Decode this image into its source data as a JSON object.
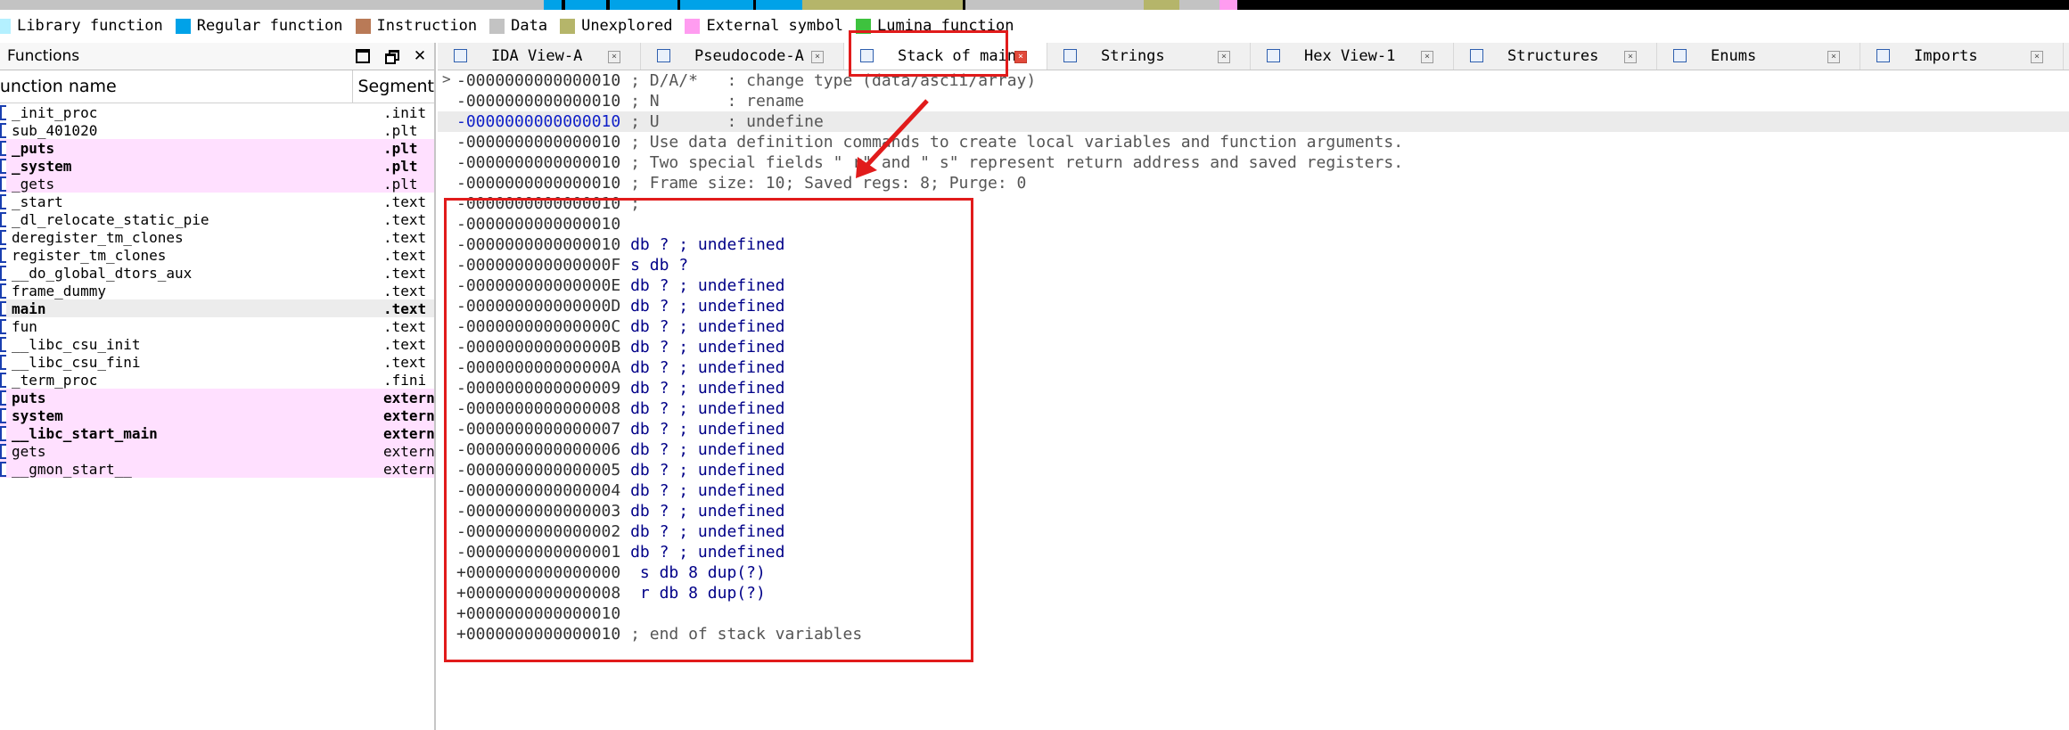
{
  "legend": [
    {
      "label": "Library function",
      "color": "#b4f0ff"
    },
    {
      "label": "Regular function",
      "color": "#00a2e8"
    },
    {
      "label": "Instruction",
      "color": "#b97a57"
    },
    {
      "label": "Data",
      "color": "#c3c3c3"
    },
    {
      "label": "Unexplored",
      "color": "#b5b56a"
    },
    {
      "label": "External symbol",
      "color": "#ff9cf0"
    },
    {
      "label": "Lumina function",
      "color": "#3ec23e"
    }
  ],
  "functions_panel": {
    "title": "Functions",
    "col_name": "Function name",
    "col_segment": "Segment",
    "rows": [
      {
        "name": "_init_proc",
        "seg": ".init",
        "style": "normal"
      },
      {
        "name": "sub_401020",
        "seg": ".plt",
        "style": "normal"
      },
      {
        "name": "_puts",
        "seg": ".plt",
        "style": "lib-bold"
      },
      {
        "name": "_system",
        "seg": ".plt",
        "style": "lib-bold"
      },
      {
        "name": "_gets",
        "seg": ".plt",
        "style": "lib"
      },
      {
        "name": "_start",
        "seg": ".text",
        "style": "normal"
      },
      {
        "name": "_dl_relocate_static_pie",
        "seg": ".text",
        "style": "normal"
      },
      {
        "name": "deregister_tm_clones",
        "seg": ".text",
        "style": "normal"
      },
      {
        "name": "register_tm_clones",
        "seg": ".text",
        "style": "normal"
      },
      {
        "name": "__do_global_dtors_aux",
        "seg": ".text",
        "style": "normal"
      },
      {
        "name": "frame_dummy",
        "seg": ".text",
        "style": "normal"
      },
      {
        "name": "main",
        "seg": ".text",
        "style": "sel-bold"
      },
      {
        "name": "fun",
        "seg": ".text",
        "style": "normal"
      },
      {
        "name": "__libc_csu_init",
        "seg": ".text",
        "style": "normal"
      },
      {
        "name": "__libc_csu_fini",
        "seg": ".text",
        "style": "normal"
      },
      {
        "name": "_term_proc",
        "seg": ".fini",
        "style": "normal"
      },
      {
        "name": "puts",
        "seg": "extern",
        "style": "lib-bold"
      },
      {
        "name": "system",
        "seg": "extern",
        "style": "lib-bold"
      },
      {
        "name": "__libc_start_main",
        "seg": "extern",
        "style": "lib-bold"
      },
      {
        "name": "gets",
        "seg": "extern",
        "style": "lib"
      },
      {
        "name": "__gmon_start__",
        "seg": "extern",
        "style": "lib"
      }
    ]
  },
  "tabs": [
    {
      "label": "IDA View-A",
      "icon": "ida-view-icon",
      "active": false
    },
    {
      "label": "Pseudocode-A",
      "icon": "pseudocode-icon",
      "active": false
    },
    {
      "label": "Stack of main",
      "icon": "stack-icon",
      "active": true
    },
    {
      "label": "Strings",
      "icon": "strings-icon",
      "active": false
    },
    {
      "label": "Hex View-1",
      "icon": "hex-view-icon",
      "active": false
    },
    {
      "label": "Structures",
      "icon": "structures-icon",
      "active": false
    },
    {
      "label": "Enums",
      "icon": "enums-icon",
      "active": false
    },
    {
      "label": "Imports",
      "icon": "imports-icon",
      "active": false
    }
  ],
  "stack_lines": [
    {
      "addr": "-0000000000000010",
      "code": " ; D/A/*   : change type (data/ascii/array)",
      "kind": "comment"
    },
    {
      "addr": "-0000000000000010",
      "code": " ; N       : rename",
      "kind": "comment"
    },
    {
      "addr": "-0000000000000010",
      "code": " ; U       : undefine",
      "kind": "comment",
      "current": true
    },
    {
      "addr": "-0000000000000010",
      "code": " ; Use data definition commands to create local variables and function arguments.",
      "kind": "comment"
    },
    {
      "addr": "-0000000000000010",
      "code": " ; Two special fields \" r\" and \" s\" represent return address and saved registers.",
      "kind": "comment"
    },
    {
      "addr": "-0000000000000010",
      "code": " ; Frame size: 10; Saved regs: 8; Purge: 0",
      "kind": "comment"
    },
    {
      "addr": "-0000000000000010",
      "code": " ;",
      "kind": "comment"
    },
    {
      "addr": "-0000000000000010",
      "code": "",
      "kind": "blank"
    },
    {
      "addr": "-0000000000000010",
      "code": " db ? ; undefined",
      "kind": "undef"
    },
    {
      "addr": "-000000000000000F",
      "code": " s db ?",
      "kind": "var"
    },
    {
      "addr": "-000000000000000E",
      "code": " db ? ; undefined",
      "kind": "undef"
    },
    {
      "addr": "-000000000000000D",
      "code": " db ? ; undefined",
      "kind": "undef"
    },
    {
      "addr": "-000000000000000C",
      "code": " db ? ; undefined",
      "kind": "undef"
    },
    {
      "addr": "-000000000000000B",
      "code": " db ? ; undefined",
      "kind": "undef"
    },
    {
      "addr": "-000000000000000A",
      "code": " db ? ; undefined",
      "kind": "undef"
    },
    {
      "addr": "-0000000000000009",
      "code": " db ? ; undefined",
      "kind": "undef"
    },
    {
      "addr": "-0000000000000008",
      "code": " db ? ; undefined",
      "kind": "undef"
    },
    {
      "addr": "-0000000000000007",
      "code": " db ? ; undefined",
      "kind": "undef"
    },
    {
      "addr": "-0000000000000006",
      "code": " db ? ; undefined",
      "kind": "undef"
    },
    {
      "addr": "-0000000000000005",
      "code": " db ? ; undefined",
      "kind": "undef"
    },
    {
      "addr": "-0000000000000004",
      "code": " db ? ; undefined",
      "kind": "undef"
    },
    {
      "addr": "-0000000000000003",
      "code": " db ? ; undefined",
      "kind": "undef"
    },
    {
      "addr": "-0000000000000002",
      "code": " db ? ; undefined",
      "kind": "undef"
    },
    {
      "addr": "-0000000000000001",
      "code": " db ? ; undefined",
      "kind": "undef"
    },
    {
      "addr": "+0000000000000000",
      "code": "  s db 8 dup(?)",
      "kind": "saved"
    },
    {
      "addr": "+0000000000000008",
      "code": "  r db 8 dup(?)",
      "kind": "saved"
    },
    {
      "addr": "+0000000000000010",
      "code": "",
      "kind": "blank"
    },
    {
      "addr": "+0000000000000010",
      "code": " ; end of stack variables",
      "kind": "comment"
    }
  ],
  "colors": {
    "highlight_red": "#e11b1b",
    "current_addr": "#1020c8",
    "external_bg": "#ffe0ff"
  }
}
